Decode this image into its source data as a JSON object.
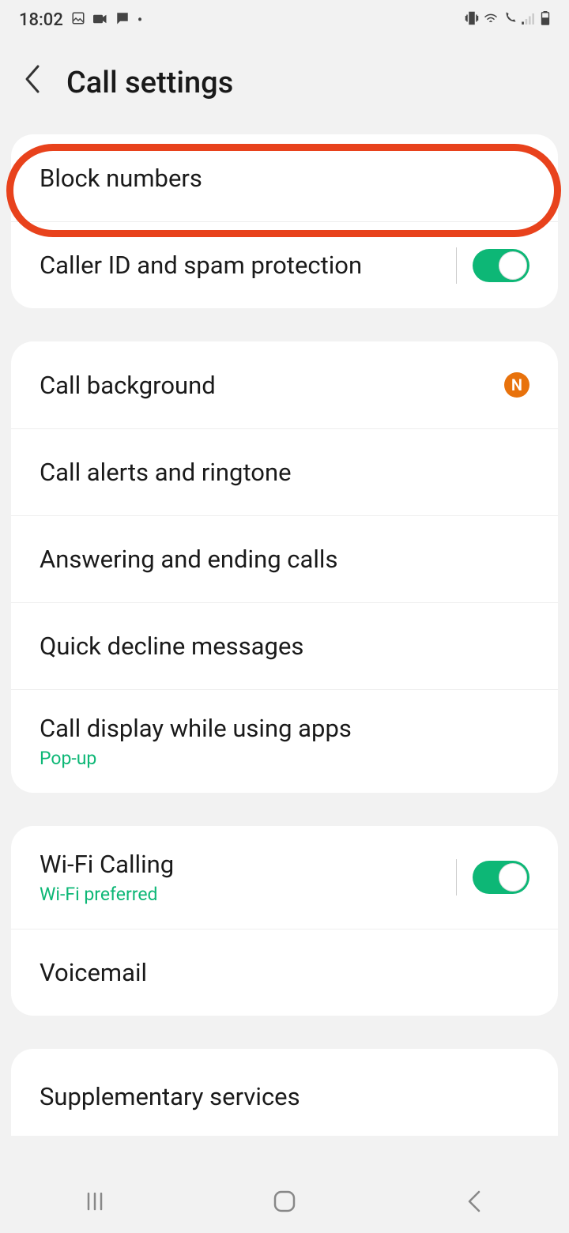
{
  "status": {
    "time": "18:02"
  },
  "header": {
    "title": "Call settings"
  },
  "groups": [
    {
      "items": [
        {
          "title": "Block numbers",
          "highlighted": true
        },
        {
          "title": "Caller ID and spam protection",
          "toggle": true,
          "toggle_on": true,
          "divider": true
        }
      ]
    },
    {
      "items": [
        {
          "title": "Call background",
          "badge": "N"
        },
        {
          "title": "Call alerts and ringtone"
        },
        {
          "title": "Answering and ending calls"
        },
        {
          "title": "Quick decline messages"
        },
        {
          "title": "Call display while using apps",
          "sub": "Pop-up"
        }
      ]
    },
    {
      "items": [
        {
          "title": "Wi-Fi Calling",
          "sub": "Wi-Fi preferred",
          "toggle": true,
          "toggle_on": true,
          "divider": true
        },
        {
          "title": "Voicemail"
        }
      ]
    },
    {
      "items": [
        {
          "title": "Supplementary services"
        }
      ]
    }
  ]
}
